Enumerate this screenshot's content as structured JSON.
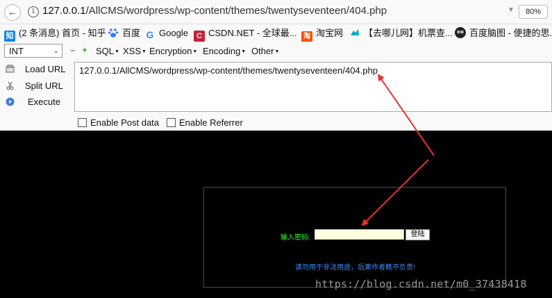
{
  "browser": {
    "url_host": "127.0.0.1",
    "url_path": "/AllCMS/wordpress/wp-content/themes/twentyseventeen/404.php",
    "zoom": "80%"
  },
  "bookmarks": [
    {
      "icon": "zhihu-icon",
      "icon_text": "知",
      "color": "#0f88eb",
      "label": "(2 条消息) 首页 - 知乎"
    },
    {
      "icon": "baidu-paw-icon",
      "icon_text": "",
      "color": "#2f7cf6",
      "label": "百度"
    },
    {
      "icon": "google-icon",
      "icon_text": "G",
      "color": "#ffffff",
      "label": "Google"
    },
    {
      "icon": "csdn-icon",
      "icon_text": "C",
      "color": "#c32136",
      "label": "CSDN.NET - 全球最..."
    },
    {
      "icon": "taobao-icon",
      "icon_text": "淘",
      "color": "#ff5000",
      "label": "淘宝网"
    },
    {
      "icon": "qunar-icon",
      "icon_text": "",
      "color": "#00afc7",
      "label": "【去哪儿网】机票查..."
    },
    {
      "icon": "baidu-naotu-icon",
      "icon_text": "",
      "color": "#222222",
      "label": "百度脑图 - 便捷的思..."
    }
  ],
  "hackbar": {
    "type_select": "INT",
    "menus": [
      "SQL",
      "XSS",
      "Encryption",
      "Encoding",
      "Other"
    ],
    "load_url": "Load URL",
    "split_url": "Split URL",
    "execute": "Execute",
    "url_value": "127.0.0.1/AllCMS/wordpress/wp-content/themes/twentyseventeen/404.php",
    "enable_post": "Enable Post data",
    "enable_referrer": "Enable Referrer"
  },
  "page": {
    "password_label": "输入密码:",
    "login_button": "登陆",
    "warning": "请勿用于非法用途，后果作者概不负责!",
    "watermark": "https://blog.csdn.net/m0_37438418"
  },
  "colors": {
    "arrow": "#e8322d",
    "label_green": "#33ff33",
    "warning_blue": "#3b8cff",
    "input_bg": "#ffffe0"
  }
}
